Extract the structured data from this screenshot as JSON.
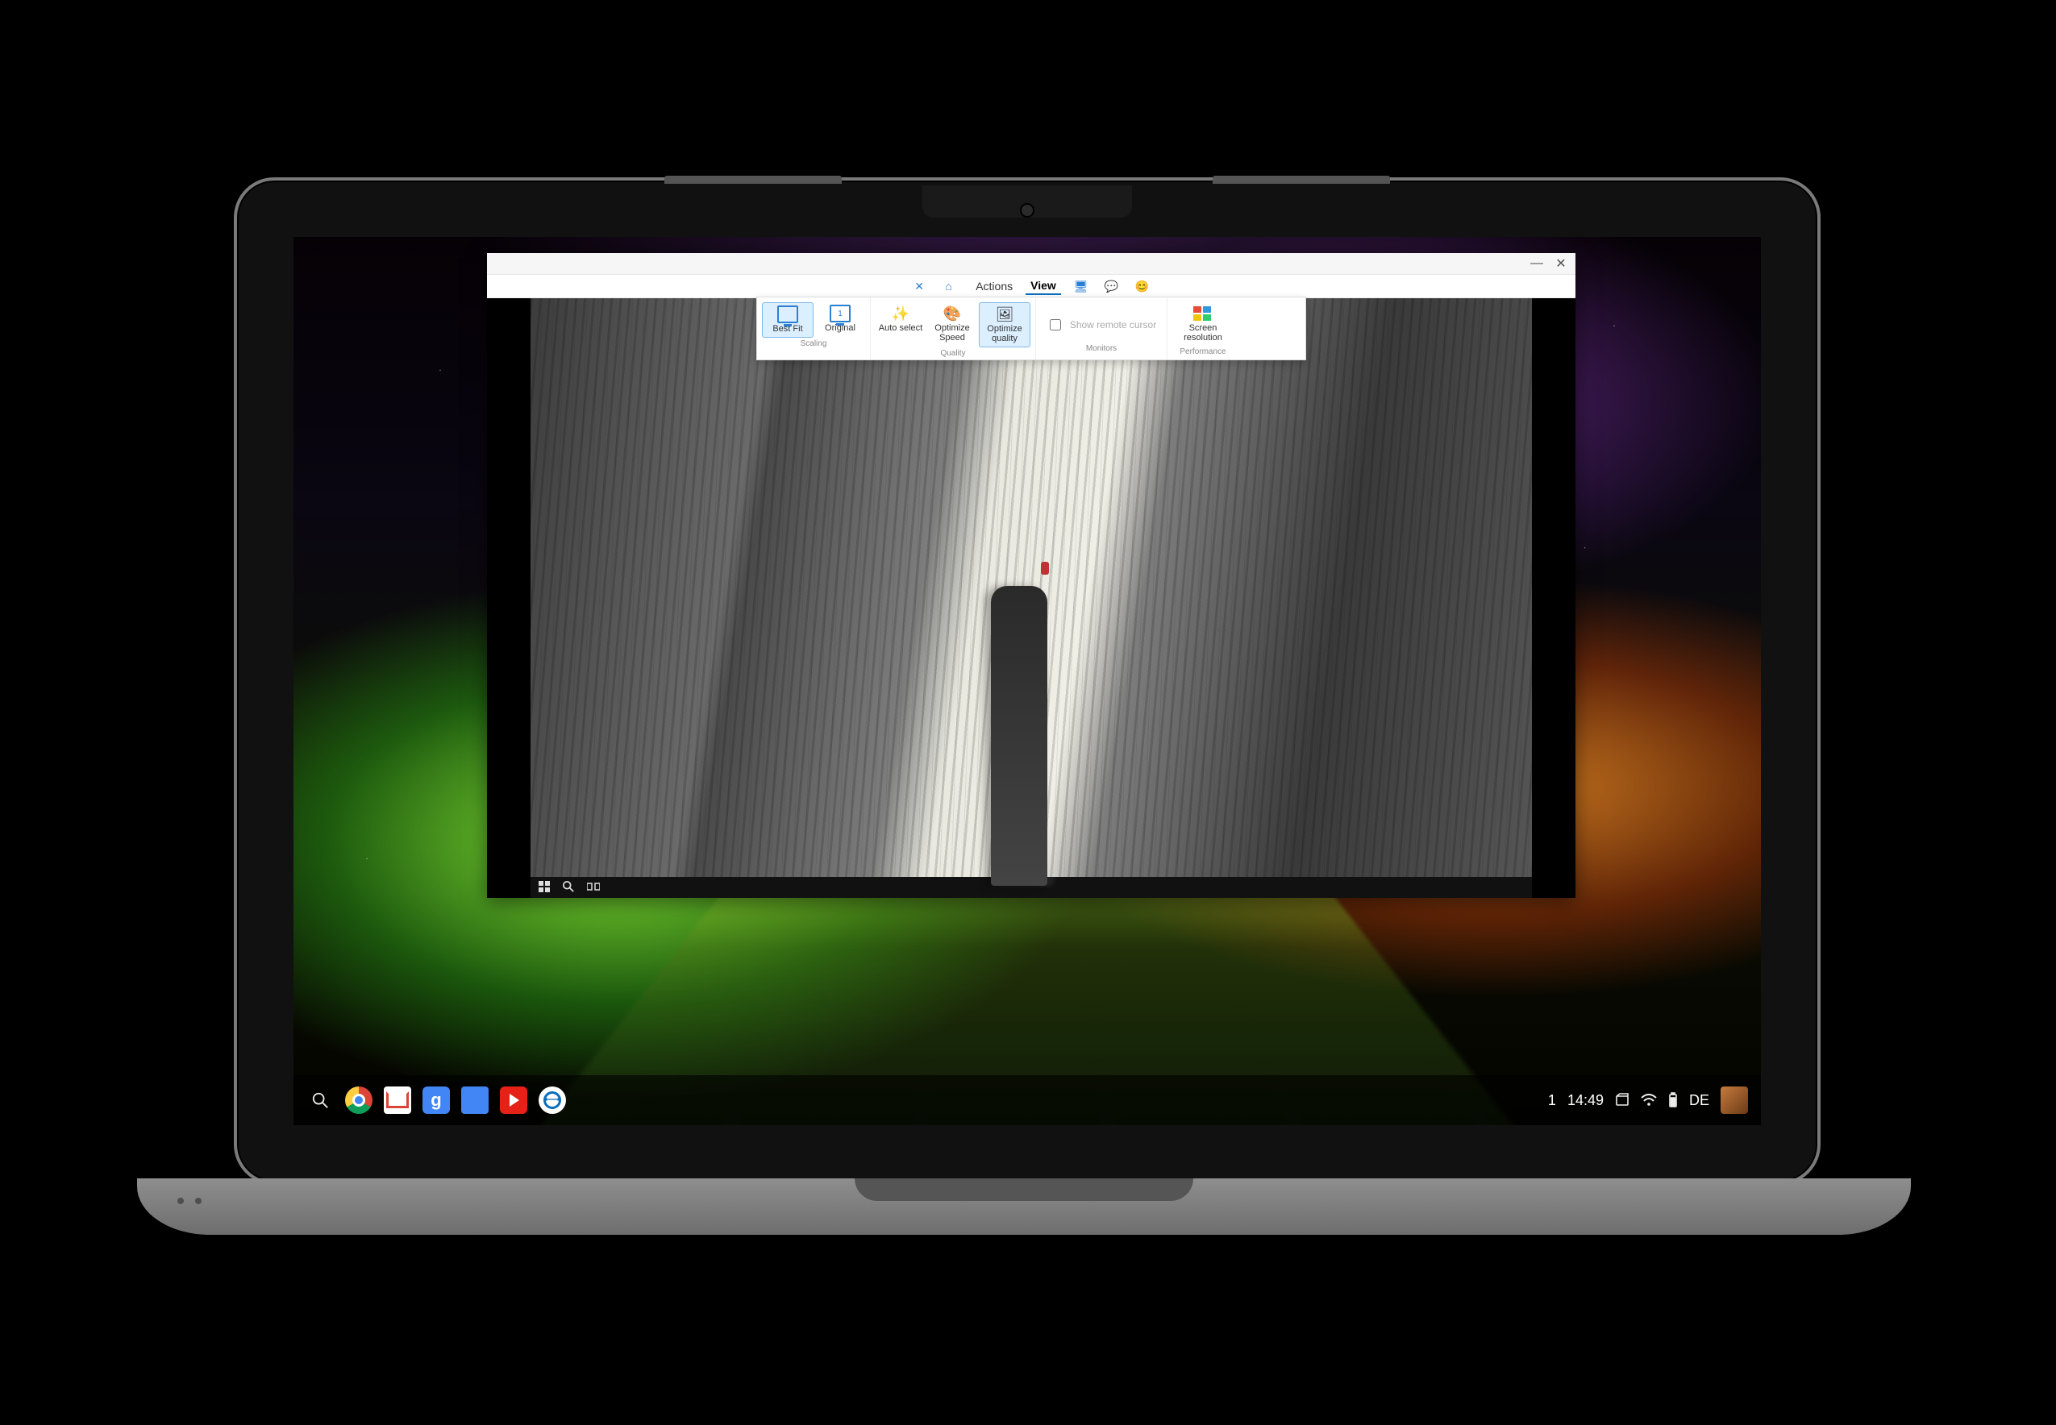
{
  "window": {
    "controls": {
      "minimize": "—",
      "close": "✕"
    },
    "menubar": {
      "close_icon": "close-icon",
      "home_icon": "home-icon",
      "actions": "Actions",
      "view": "View",
      "devices_icon": "devices-icon",
      "chat_icon": "chat-icon",
      "emoji_icon": "emoji-icon"
    },
    "ribbon": {
      "scaling": {
        "label": "Scaling",
        "best_fit": "Best Fit",
        "original": "Original"
      },
      "quality": {
        "label": "Quality",
        "auto_select": "Auto select",
        "optimize_speed": "Optimize Speed",
        "optimize_quality": "Optimize quality"
      },
      "cursor": {
        "label": "Monitors",
        "show_remote_cursor": "Show remote cursor"
      },
      "performance": {
        "label": "Performance",
        "screen_resolution": "Screen resolution"
      }
    }
  },
  "remote": {
    "taskbar": {
      "start_icon": "windows-start-icon",
      "search_icon": "search-icon",
      "taskview_icon": "task-view-icon"
    }
  },
  "shelf": {
    "left_icons": [
      {
        "name": "launcher-search-icon"
      },
      {
        "name": "chrome-app-icon"
      },
      {
        "name": "gmail-app-icon"
      },
      {
        "name": "google-search-app-icon"
      },
      {
        "name": "google-docs-app-icon"
      },
      {
        "name": "youtube-app-icon"
      },
      {
        "name": "teamviewer-app-icon"
      }
    ],
    "status": {
      "notification_count": "1",
      "time": "14:49",
      "tab_icon": "tab-icon",
      "wifi_icon": "wifi-icon",
      "battery_icon": "battery-icon",
      "language": "DE",
      "avatar_icon": "user-avatar-icon"
    }
  }
}
